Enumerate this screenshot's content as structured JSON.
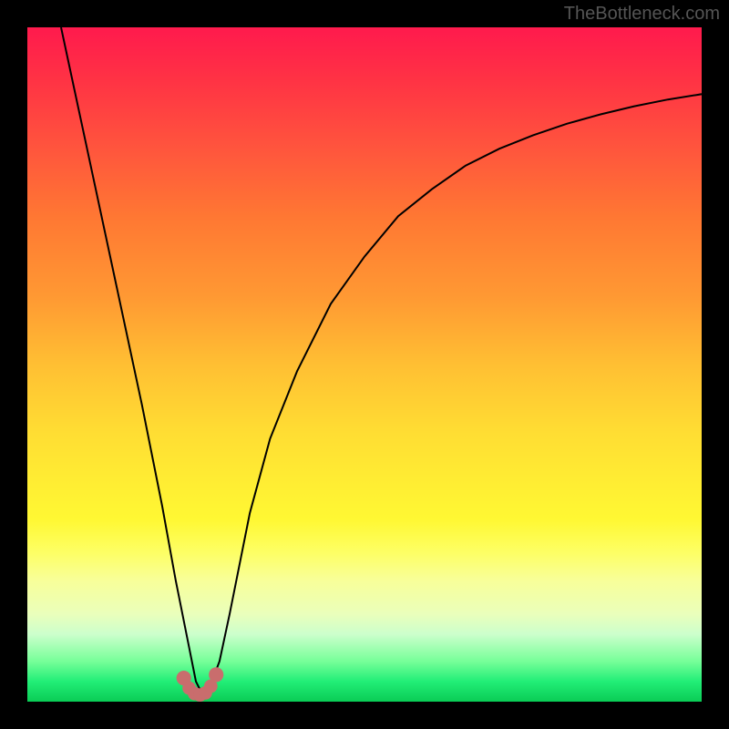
{
  "watermark": {
    "text": "TheBottleneck.com"
  },
  "chart_data": {
    "type": "line",
    "title": "",
    "xlabel": "",
    "ylabel": "",
    "xlim": [
      0,
      100
    ],
    "ylim": [
      0,
      100
    ],
    "gradient_stops": [
      {
        "name": "top-red",
        "color": "#ff1a4d",
        "pos": 0
      },
      {
        "name": "orange",
        "color": "#ff9933",
        "pos": 40
      },
      {
        "name": "yellow",
        "color": "#ffee33",
        "pos": 68
      },
      {
        "name": "pale",
        "color": "#f8ff99",
        "pos": 82
      },
      {
        "name": "green",
        "color": "#0acc55",
        "pos": 100
      }
    ],
    "series": [
      {
        "name": "bottleneck-curve",
        "x": [
          5,
          8,
          11,
          14,
          17,
          20,
          22,
          24,
          25,
          26,
          27,
          28.5,
          30,
          33,
          36,
          40,
          45,
          50,
          55,
          60,
          65,
          70,
          75,
          80,
          85,
          90,
          95,
          100
        ],
        "y": [
          100,
          86,
          72,
          58,
          44,
          29,
          18,
          8,
          3,
          1,
          2,
          6,
          13,
          28,
          39,
          49,
          59,
          66,
          72,
          76,
          79.5,
          82,
          84,
          85.7,
          87.1,
          88.3,
          89.3,
          90.1
        ]
      }
    ],
    "markers": {
      "name": "bottom-highlight",
      "color": "#c96d6d",
      "points": [
        {
          "x": 23.2,
          "y": 3.5,
          "r": 1.1
        },
        {
          "x": 24.0,
          "y": 2.0,
          "r": 1.0
        },
        {
          "x": 24.8,
          "y": 1.2,
          "r": 1.0
        },
        {
          "x": 25.6,
          "y": 1.0,
          "r": 1.0
        },
        {
          "x": 26.4,
          "y": 1.3,
          "r": 1.0
        },
        {
          "x": 27.2,
          "y": 2.3,
          "r": 1.0
        },
        {
          "x": 28.0,
          "y": 4.0,
          "r": 1.1
        }
      ]
    }
  }
}
